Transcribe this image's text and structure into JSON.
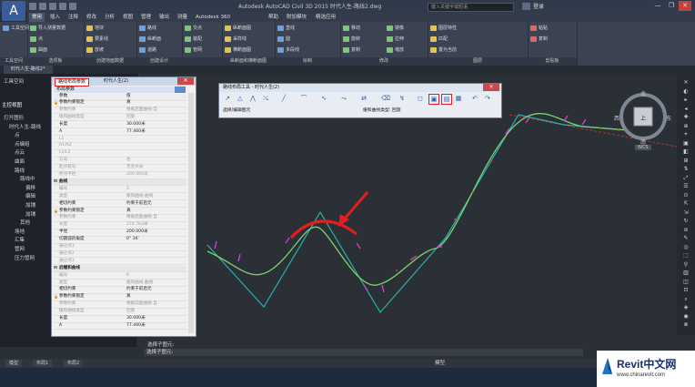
{
  "titlebar": {
    "title": "Autodesk AutoCAD Civil 3D 2015   时代人生-路线2.dwg",
    "search_placeholder": "键入关键字或短语",
    "login": "登录",
    "window_buttons": [
      "—",
      "❐",
      "✕"
    ]
  },
  "menu": {
    "tabs": [
      "常用",
      "插入",
      "注释",
      "修改",
      "分析",
      "视图",
      "管理",
      "输出",
      "测量",
      "Autodesk 360",
      "帮助",
      "附加模块",
      "精选应用"
    ],
    "active_index": 0
  },
  "ribbon": {
    "panels": [
      {
        "title": "工具空间",
        "buttons": [
          "工具空间"
        ]
      },
      {
        "title": "选项板",
        "buttons": [
          "导入测量数据",
          "点",
          "曲面"
        ]
      },
      {
        "title": "创建地面数据",
        "buttons": [
          "地块",
          "要素线",
          "放坡"
        ]
      },
      {
        "title": "创建设计",
        "buttons": [
          "路线",
          "纵断面",
          "道路"
        ]
      },
      {
        "title": "",
        "buttons": [
          "交点",
          "装配",
          "管网"
        ]
      },
      {
        "title": "纵断面和横断面图",
        "buttons": [
          "纵断面图",
          "采样线",
          "横断面图"
        ]
      },
      {
        "title": "绘制",
        "buttons": [
          "直线",
          "圆",
          "多段线"
        ]
      },
      {
        "title": "修改",
        "buttons": [
          "移动",
          "旋转",
          "复制",
          "镜像",
          "拉伸",
          "缩放"
        ]
      },
      {
        "title": "图层",
        "buttons": [
          "图层特性",
          "匹配",
          "置为当前"
        ]
      },
      {
        "title": "剪贴板",
        "buttons": [
          "粘贴",
          "复制"
        ]
      }
    ]
  },
  "document": {
    "tab": "时代人生-路线2*"
  },
  "toolspace": {
    "title": "工具空间",
    "section": "主控视图",
    "tree": [
      "打开图形",
      "时代人生-路线",
      "点",
      "点编组",
      "点云",
      "曲面",
      "路线",
      "路线中",
      "偏移",
      "编辑",
      "加铺",
      "加铺",
      "其他",
      "场地",
      "汇集",
      "管网",
      "压力管网"
    ]
  },
  "properties": {
    "tab_active": "路线布局参数",
    "tab_other": "时代人生(2)",
    "subtitle": "布局参数",
    "header": {
      "k": "参数",
      "v": "值"
    },
    "rows": [
      {
        "k": "参数约束锁定",
        "v": "真",
        "type": "lock"
      },
      {
        "k": "参数约束",
        "v": "根据后面曲线-自",
        "type": "dim"
      },
      {
        "k": "缓和曲线类型",
        "v": "回旋",
        "type": "dim"
      },
      {
        "k": "长度",
        "v": "30.000米",
        "type": "normal"
      },
      {
        "k": "A",
        "v": "77.460米",
        "type": "normal"
      },
      {
        "k": "L1",
        "v": "",
        "type": "dim"
      },
      {
        "k": "A1/A2",
        "v": "",
        "type": "dim"
      },
      {
        "k": "L1/L2",
        "v": "",
        "type": "dim"
      },
      {
        "k": "方向",
        "v": "右",
        "type": "dim"
      },
      {
        "k": "起点桩号",
        "v": "无穷大米",
        "type": "dim"
      },
      {
        "k": "终点半径",
        "v": "200.000米",
        "type": "dim"
      },
      {
        "k": "曲线",
        "v": "",
        "type": "section"
      },
      {
        "k": "编号",
        "v": "5",
        "type": "dim"
      },
      {
        "k": "类型",
        "v": "缓和曲线-曲线",
        "type": "dim"
      },
      {
        "k": "相切约束",
        "v": "约束于前后元",
        "type": "normal"
      },
      {
        "k": "参数约束锁定",
        "v": "真",
        "type": "lock"
      },
      {
        "k": "参数约束",
        "v": "根据后面曲线-自",
        "type": "dim"
      },
      {
        "k": "长度",
        "v": "274.763米",
        "type": "dim"
      },
      {
        "k": "半径",
        "v": "200.000米",
        "type": "normal"
      },
      {
        "k": "切圆弧的角度",
        "v": "0° 36'",
        "type": "normal"
      },
      {
        "k": "通过点1",
        "v": "",
        "type": "dim"
      },
      {
        "k": "通过点2",
        "v": "",
        "type": "dim"
      },
      {
        "k": "通过点3",
        "v": "",
        "type": "dim"
      },
      {
        "k": "后缓和曲线",
        "v": "",
        "type": "section"
      },
      {
        "k": "编号",
        "v": "6",
        "type": "dim"
      },
      {
        "k": "类型",
        "v": "缓和曲线-曲线",
        "type": "dim"
      },
      {
        "k": "相切约束",
        "v": "约束于前后元",
        "type": "normal"
      },
      {
        "k": "参数约束锁定",
        "v": "真",
        "type": "lock"
      },
      {
        "k": "参数约束",
        "v": "根据前面曲线-自",
        "type": "dim"
      },
      {
        "k": "缓和曲线类型",
        "v": "回旋",
        "type": "dim"
      },
      {
        "k": "长度",
        "v": "30.000米",
        "type": "normal"
      },
      {
        "k": "A",
        "v": "77.460米",
        "type": "normal"
      }
    ]
  },
  "layout_toolbar": {
    "title": "路线布局工具 - 时代人生(2)",
    "row2_left": "选择/编辑图元",
    "row2_right": "缓和曲线类型: 回旋"
  },
  "viewcube": {
    "north": "北",
    "south": "南",
    "east": "东",
    "west": "西",
    "top": "上",
    "wcs": "WCS"
  },
  "command": {
    "history": "选择子图元:",
    "prompt": "选择子图元:"
  },
  "statusbar": {
    "tabs": [
      "模型",
      "布局1",
      "布局2"
    ],
    "mode": "模型"
  },
  "watermark": {
    "title": "Revit中文网",
    "url": "www.chinarevit.com"
  },
  "colors": {
    "red_highlight": "#e21e1e",
    "alignment_green": "#6fd46f",
    "tangent_cyan": "#28b0b0",
    "accent_magenta": "#d23cd2"
  }
}
